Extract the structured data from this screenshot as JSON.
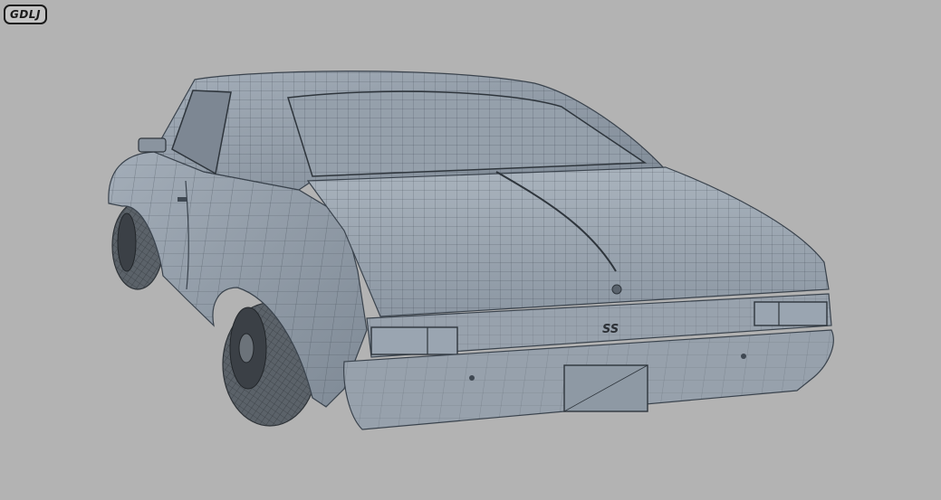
{
  "logo": {
    "text": "GDLJ"
  },
  "model": {
    "badge_text": "SS",
    "colors": {
      "background": "#b3b3b3",
      "body": "#8f9aa6",
      "body_light": "#a9b3bd",
      "body_dark": "#6f7a86",
      "wire": "#3a434d",
      "tire": "#565d64",
      "glass": "#7d8793"
    }
  }
}
